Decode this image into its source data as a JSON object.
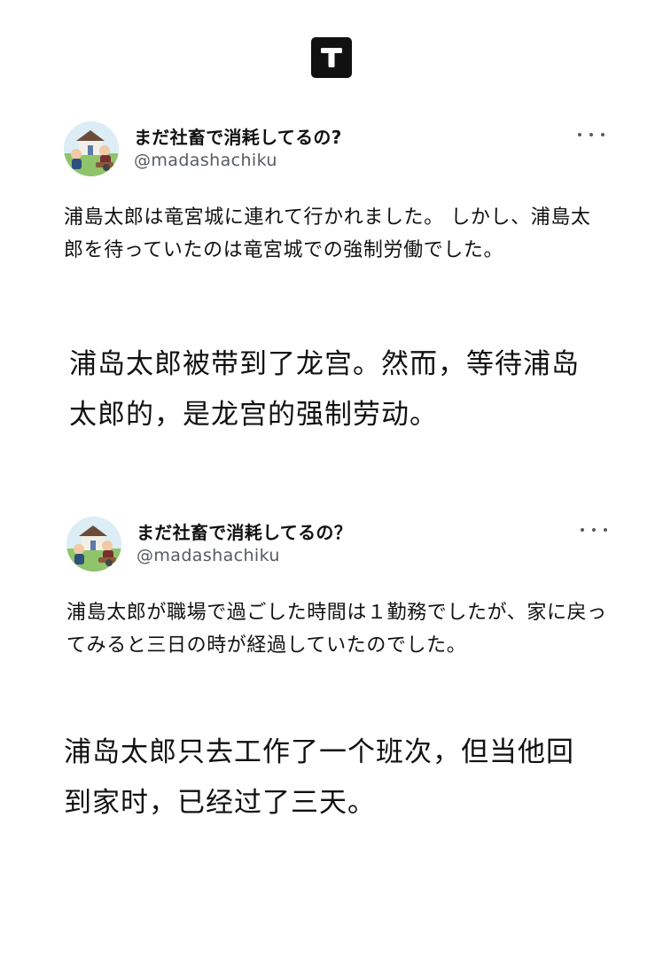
{
  "app": {
    "logo_letter": "T"
  },
  "posts": [
    {
      "author": {
        "name": "まだ社畜で消耗してるの?",
        "handle": "@madashachiku"
      },
      "text": "浦島太郎は竜宮城に連れて行かれました。 しかし、浦島太郎を待っていたのは竜宮城での強制労働でした。",
      "translation": "浦岛太郎被带到了龙宫。然而，等待浦岛太郎的，是龙宫的强制劳动。"
    },
    {
      "author": {
        "name": "まだ社畜で消耗してるの？",
        "handle": "@madashachiku"
      },
      "text": "浦島太郎が職場で過ごした時間は１勤務でしたが、家に戻ってみると三日の時が経過していたのでした。",
      "translation": "浦岛太郎只去工作了一个班次，但当他回到家时，已经过了三天。"
    }
  ],
  "icons": {
    "logo": "t-logo-icon",
    "more": "more-horizontal-icon",
    "avatar": "avatar-illustration"
  },
  "colors": {
    "text": "#111111",
    "handle": "#555b60",
    "logo_bg": "#111111"
  }
}
